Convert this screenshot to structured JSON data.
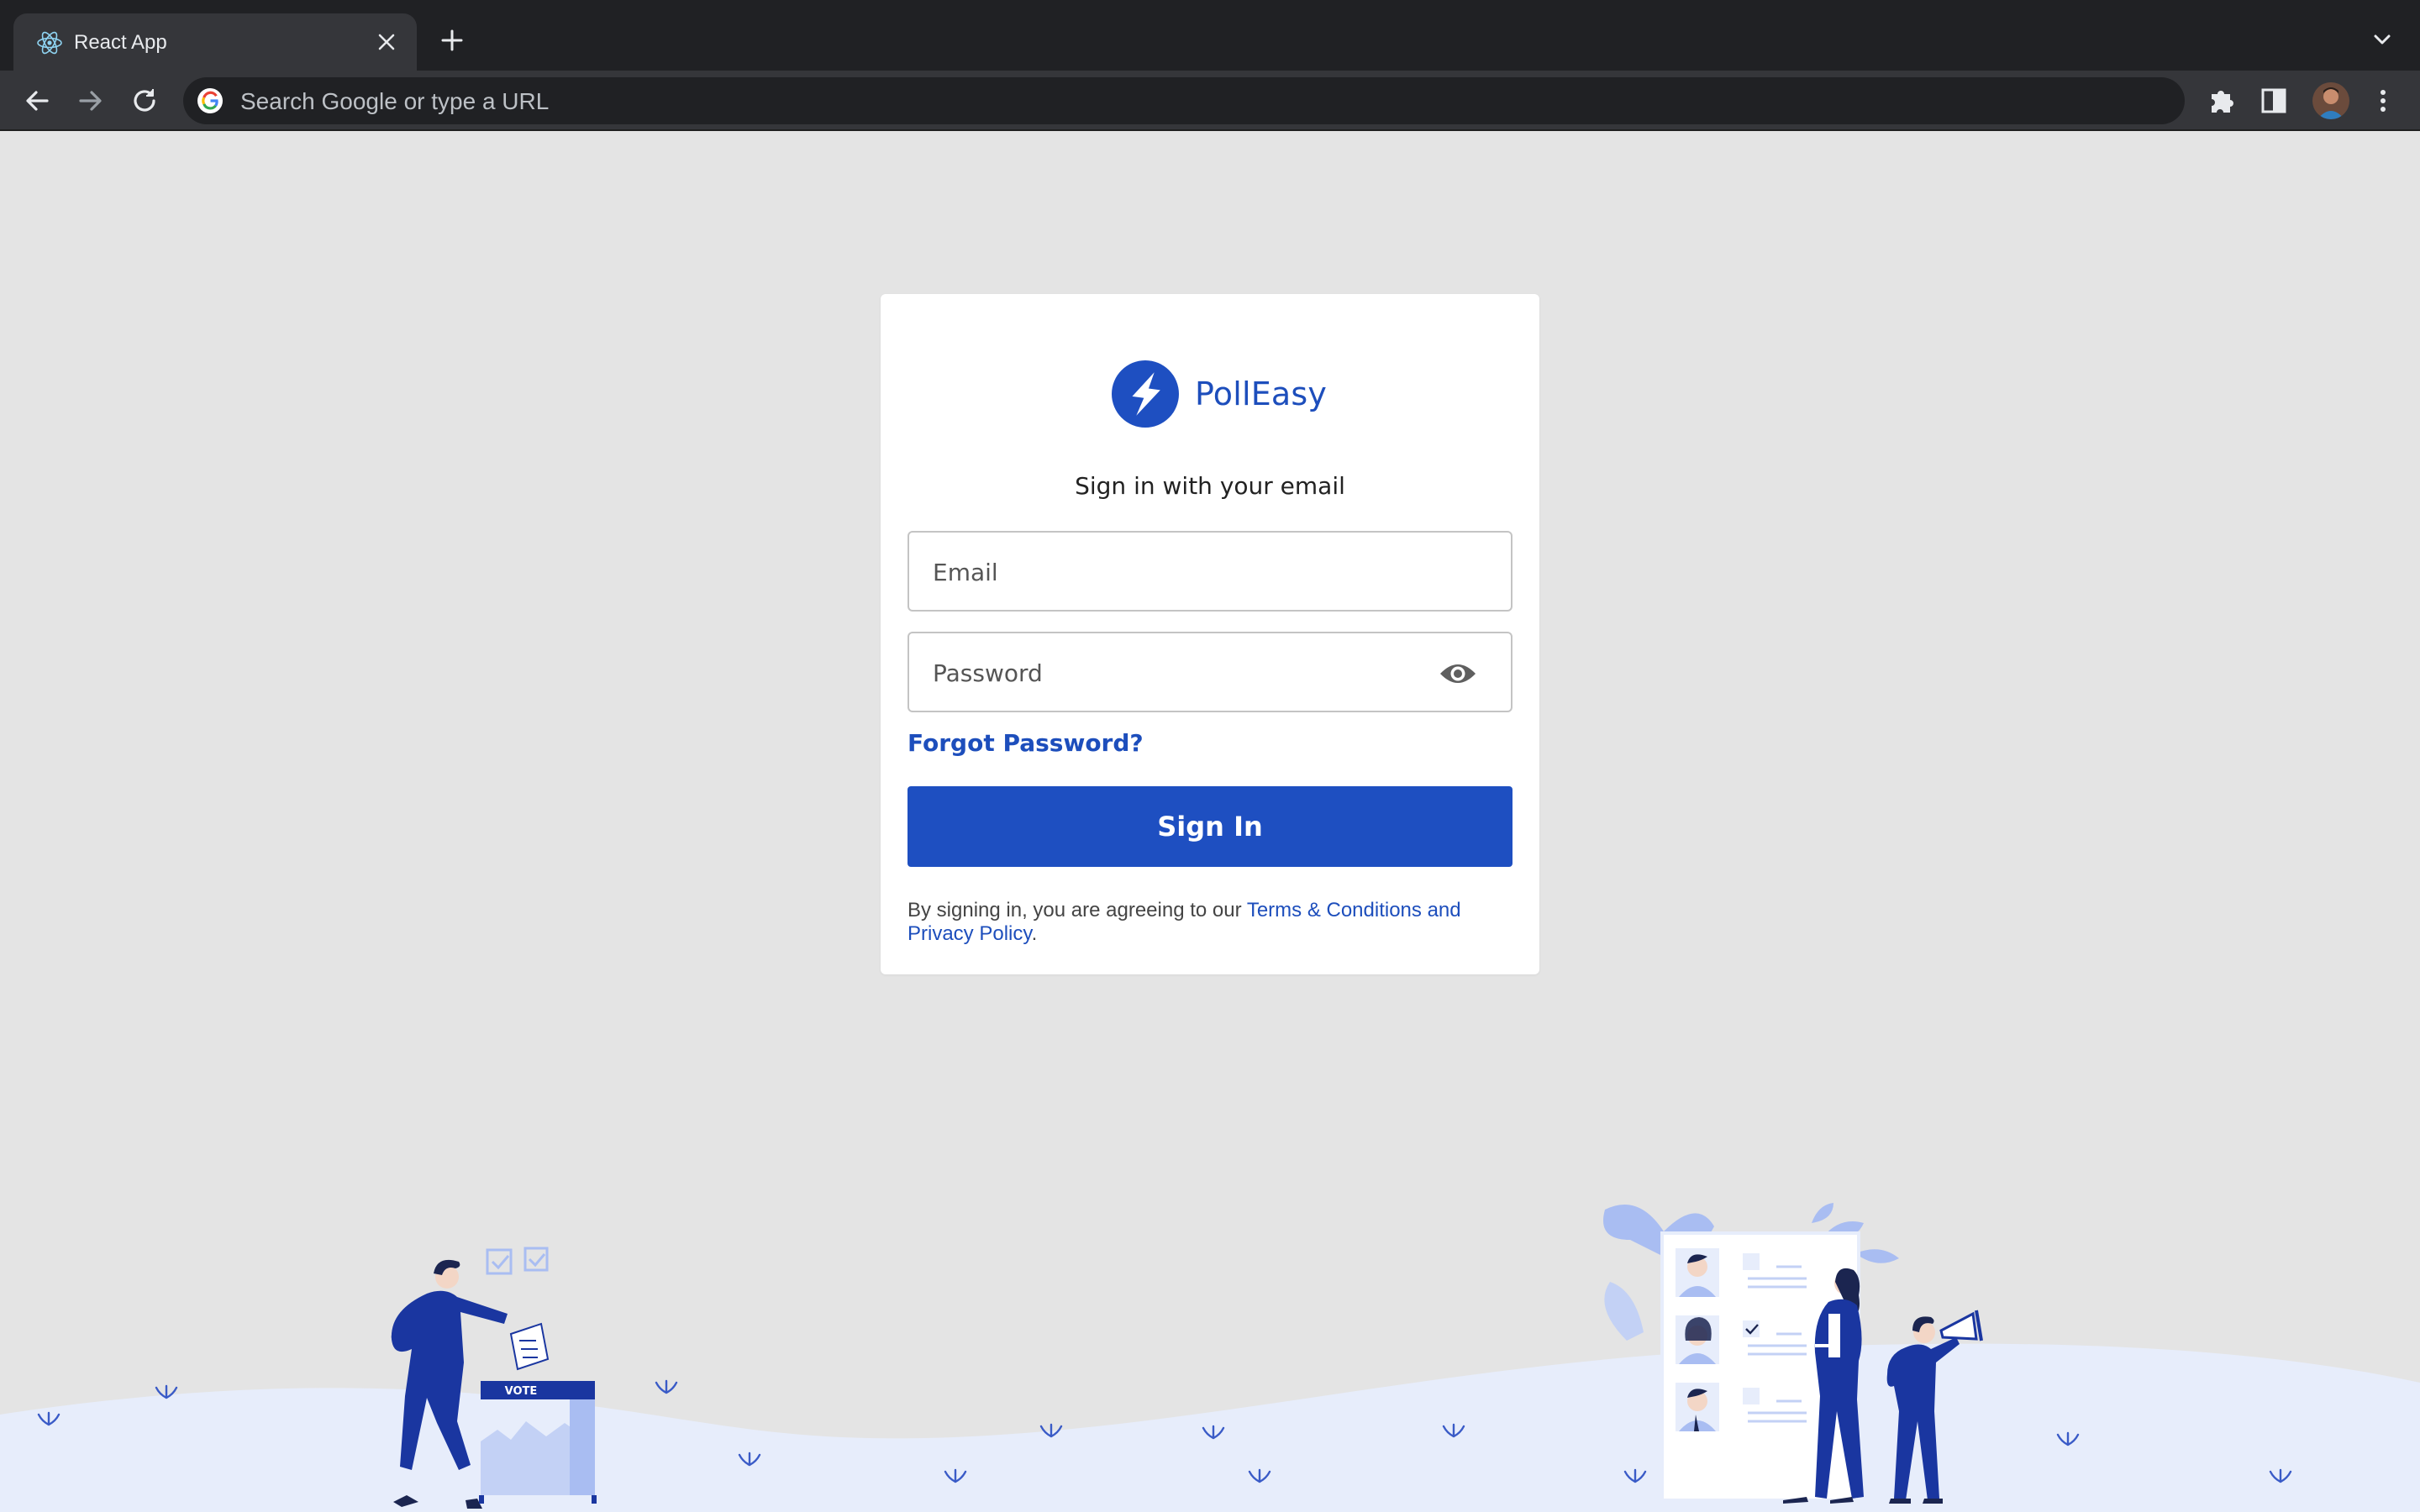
{
  "browser": {
    "tab": {
      "title": "React App",
      "favicon": "react-icon",
      "close": "close-icon"
    },
    "new_tab": "plus-icon",
    "tab_menu": "chevron-down-icon",
    "toolbar": {
      "back": "back-arrow-icon",
      "forward": "forward-arrow-icon",
      "reload": "reload-icon",
      "omnibox_placeholder": "Search Google or type a URL",
      "omnibox_icon": "google-icon",
      "extensions": "puzzle-icon",
      "side_panel": "side-panel-icon",
      "profile": "avatar",
      "menu": "kebab-menu-icon"
    },
    "colors": {
      "tabbar": "#202124",
      "toolbar": "#35363a",
      "omnibox": "#202124"
    }
  },
  "login": {
    "brand": "PollEasy",
    "logo_icon": "lightning-bolt-icon",
    "subtitle": "Sign in with your email",
    "email_placeholder": "Email",
    "password_placeholder": "Password",
    "password_toggle_icon": "eye-icon",
    "forgot_password": "Forgot Password?",
    "submit_label": "Sign In",
    "legal_prefix": "By signing in, you are agreeing to our ",
    "legal_link": "Terms & Conditions and Privacy Policy",
    "legal_suffix": "."
  },
  "illustration": {
    "ballot_box_label": "VOTE"
  },
  "colors": {
    "page_background": "#e4e4e4",
    "primary": "#1e4fc1",
    "ground": "#e7edfb",
    "figure_navy": "#1a36a0",
    "accent_light": "#a9bdf2"
  }
}
